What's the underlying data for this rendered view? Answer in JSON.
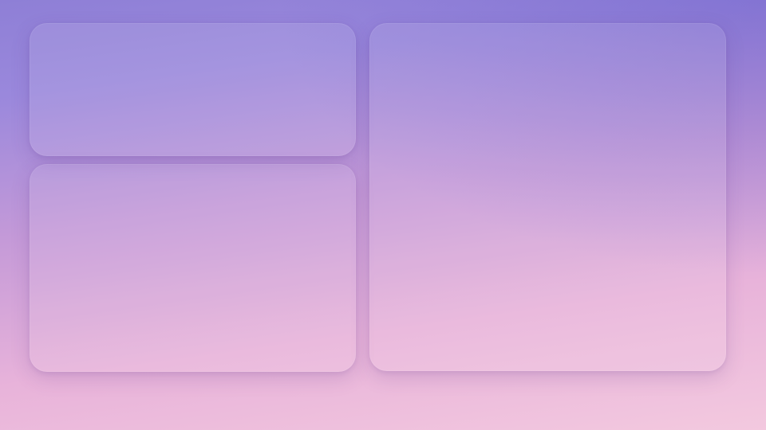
{
  "desktop": {
    "panels": [
      {
        "id": "top-left"
      },
      {
        "id": "bottom-left"
      },
      {
        "id": "right"
      }
    ]
  }
}
